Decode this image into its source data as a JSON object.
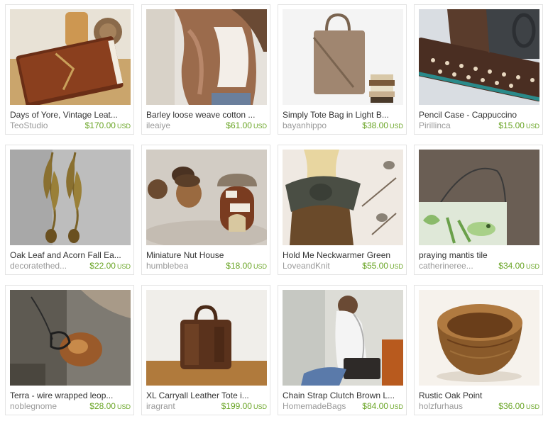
{
  "listings": [
    {
      "title": "Days of Yore, Vintage Leat...",
      "shop": "TeoStudio",
      "price": "$170.00",
      "currency": "USD",
      "image": "leather-journal"
    },
    {
      "title": "Barley loose weave cotton ...",
      "shop": "ileaiye",
      "price": "$61.00",
      "currency": "USD",
      "image": "knit-shrug"
    },
    {
      "title": "Simply Tote Bag in Light B...",
      "shop": "bayanhippo",
      "price": "$38.00",
      "currency": "USD",
      "image": "tote-bag"
    },
    {
      "title": "Pencil Case - Cappuccino",
      "shop": "Pirillinca",
      "price": "$15.00",
      "currency": "USD",
      "image": "pencil-case"
    },
    {
      "title": "Oak Leaf and Acorn Fall Ea...",
      "shop": "decoratethed...",
      "price": "$22.00",
      "currency": "USD",
      "image": "leaf-earrings"
    },
    {
      "title": "Miniature Nut House",
      "shop": "humblebea",
      "price": "$18.00",
      "currency": "USD",
      "image": "nut-house"
    },
    {
      "title": "Hold Me Neckwarmer Green",
      "shop": "LoveandKnit",
      "price": "$55.00",
      "currency": "USD",
      "image": "neckwarmer"
    },
    {
      "title": "praying mantis tile",
      "shop": "catherineree...",
      "price": "$34.00",
      "currency": "USD",
      "image": "mantis-tile"
    },
    {
      "title": "Terra - wire wrapped leop...",
      "shop": "noblegnome",
      "price": "$28.00",
      "currency": "USD",
      "image": "stone-pendant"
    },
    {
      "title": "XL Carryall Leather Tote i...",
      "shop": "iragrant",
      "price": "$199.00",
      "currency": "USD",
      "image": "leather-tote"
    },
    {
      "title": "Chain Strap Clutch Brown L...",
      "shop": "HomemadeBags",
      "price": "$84.00",
      "currency": "USD",
      "image": "chain-clutch"
    },
    {
      "title": "Rustic Oak Point",
      "shop": "holzfurhaus",
      "price": "$36.00",
      "currency": "USD",
      "image": "oak-bowl"
    }
  ]
}
